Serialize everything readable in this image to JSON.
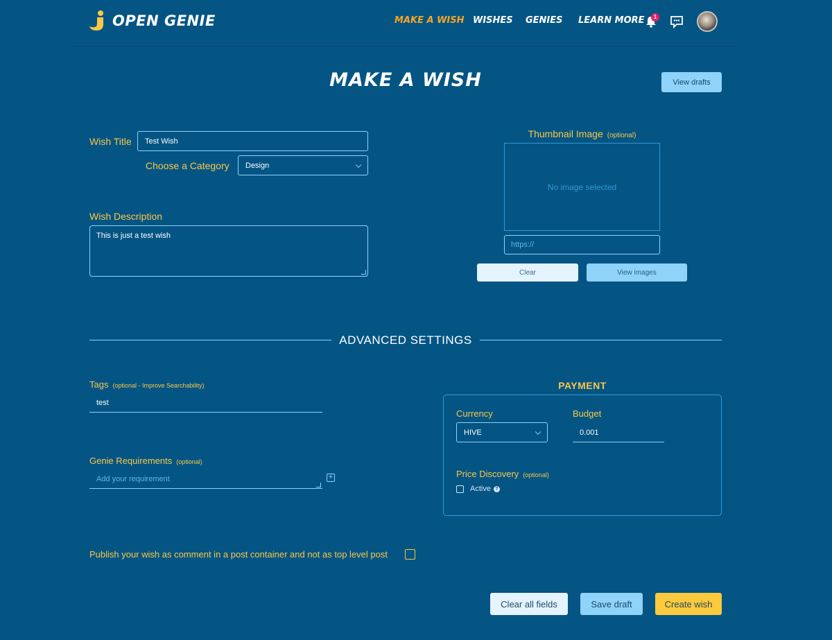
{
  "header": {
    "logo_text": "OPEN GENIE",
    "nav": [
      {
        "label": "MAKE A WISH",
        "active": true
      },
      {
        "label": "WISHES",
        "active": false
      },
      {
        "label": "GENIES",
        "active": false
      },
      {
        "label": "LEARN MORE",
        "active": false
      }
    ],
    "notification_count": "1",
    "icons": [
      "bell-icon",
      "chat-icon",
      "avatar"
    ]
  },
  "page": {
    "title": "MAKE A WISH",
    "view_drafts_label": "View drafts"
  },
  "form": {
    "wish_title_label": "Wish Title",
    "wish_title_value": "Test Wish",
    "category_label": "Choose a Category",
    "category_value": "Design",
    "description_label": "Wish Description",
    "description_value": "This is just a test wish",
    "thumbnail_label": "Thumbnail Image",
    "thumbnail_optional": "(optional)",
    "no_image_text": "No image selected",
    "url_placeholder": "https://",
    "clear_label": "Clear",
    "view_images_label": "View images"
  },
  "advanced": {
    "title": "ADVANCED SETTINGS",
    "tags_label": "Tags",
    "tags_optional": "(optional - Improve Searchability)",
    "tags_value": "test",
    "requirements_label": "Genie Requirements",
    "requirements_optional": "(optional)",
    "requirements_placeholder": "Add your requirement"
  },
  "payment": {
    "title": "PAYMENT",
    "currency_label": "Currency",
    "currency_value": "HIVE",
    "budget_label": "Budget",
    "budget_value": "0.001",
    "price_discovery_label": "Price Discovery",
    "price_discovery_optional": "(optional)",
    "active_label": "Active"
  },
  "publish": {
    "label": "Publish your wish as comment in a post container and not as top level post"
  },
  "actions": {
    "clear_all_label": "Clear all fields",
    "save_draft_label": "Save draft",
    "create_wish_label": "Create wish"
  },
  "colors": {
    "background": "#055584",
    "accent_yellow": "#f9c748",
    "accent_orange": "#f5a623",
    "light_blue": "#8fd3fb"
  }
}
